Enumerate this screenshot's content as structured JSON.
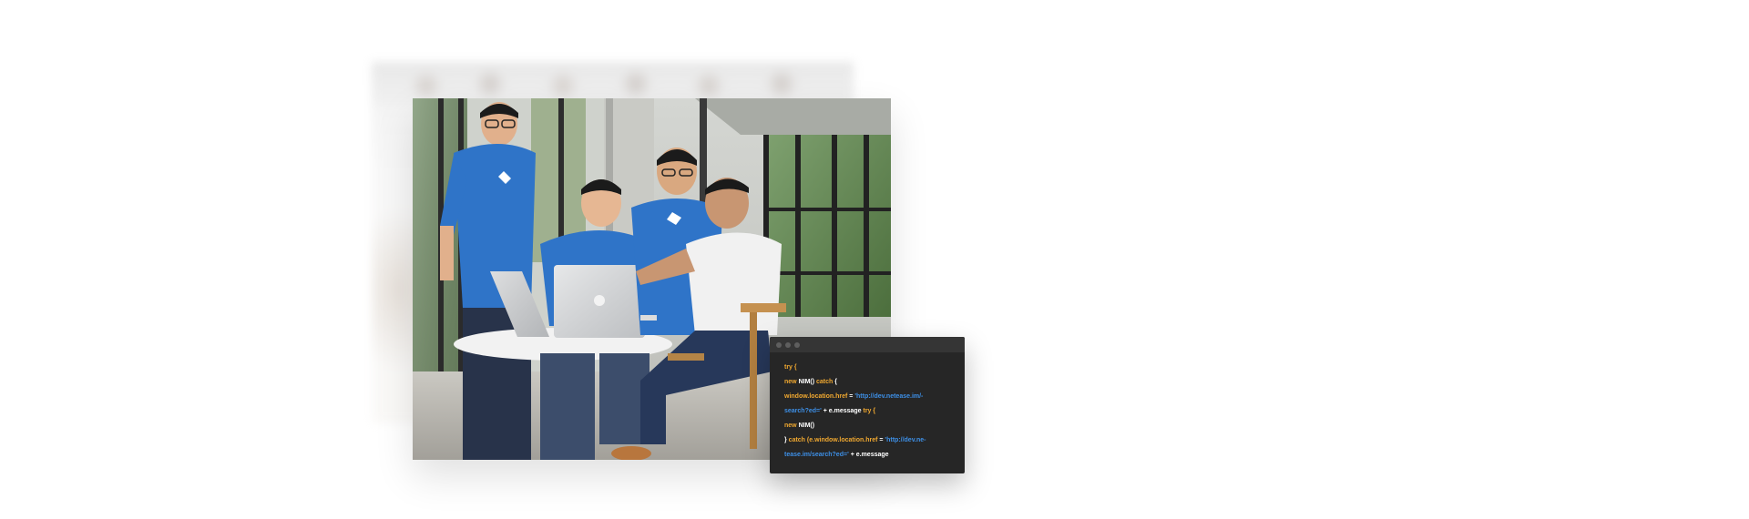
{
  "colors": {
    "keyword": "#f0a830",
    "plain": "#ffffff",
    "string": "#3d8fe6",
    "window_bg": "#262626",
    "titlebar_bg": "#353535",
    "shirt_blue": "#2f74c8"
  },
  "code_window": {
    "lines": [
      [
        {
          "t": "k",
          "v": "try {"
        }
      ],
      [
        {
          "t": "k",
          "v": "new "
        },
        {
          "t": "w",
          "v": "NIM() "
        },
        {
          "t": "k",
          "v": "catch "
        },
        {
          "t": "w",
          "v": " {"
        }
      ],
      [
        {
          "t": "k",
          "v": "window.location.href "
        },
        {
          "t": "w",
          "v": "= "
        },
        {
          "t": "b",
          "v": "'http://dev.netease.im/-"
        }
      ],
      [
        {
          "t": "b",
          "v": "search?ed=' "
        },
        {
          "t": "w",
          "v": " + e.message "
        },
        {
          "t": "k",
          "v": "try {"
        }
      ],
      [
        {
          "t": "k",
          "v": "new "
        },
        {
          "t": "w",
          "v": "NIM()"
        }
      ],
      [
        {
          "t": "w",
          "v": "} "
        },
        {
          "t": "k",
          "v": "catch  (e.window.location.href "
        },
        {
          "t": "w",
          "v": "= "
        },
        {
          "t": "b",
          "v": "'http://dev.ne-"
        }
      ],
      [
        {
          "t": "b",
          "v": "tease.im/search?ed=' "
        },
        {
          "t": "w",
          "v": " + "
        },
        {
          "t": "w",
          "v": "e.message"
        }
      ]
    ]
  }
}
